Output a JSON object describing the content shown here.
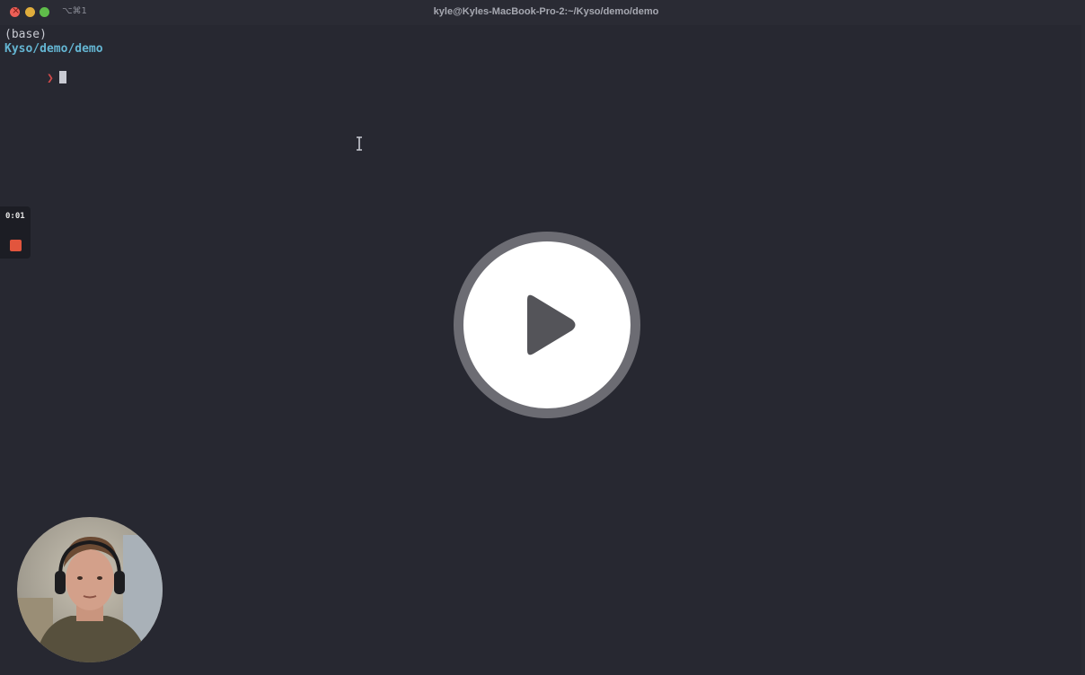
{
  "window": {
    "title": "kyle@Kyles-MacBook-Pro-2:~/Kyso/demo/demo",
    "shortcut": "⌥⌘1",
    "controls": [
      "close-icon",
      "minimize-icon",
      "maximize-icon"
    ]
  },
  "terminal": {
    "env_line": "(base)",
    "path_line": "Kyso/demo/demo",
    "prompt_symbol": "❯"
  },
  "recorder": {
    "elapsed": "0:01",
    "stop_icon": "stop-icon",
    "stop_color": "#e2553d"
  },
  "player": {
    "play_icon": "play-icon"
  },
  "colors": {
    "background": "#272831",
    "path": "#64b5d2",
    "prompt": "#d04a4a"
  }
}
